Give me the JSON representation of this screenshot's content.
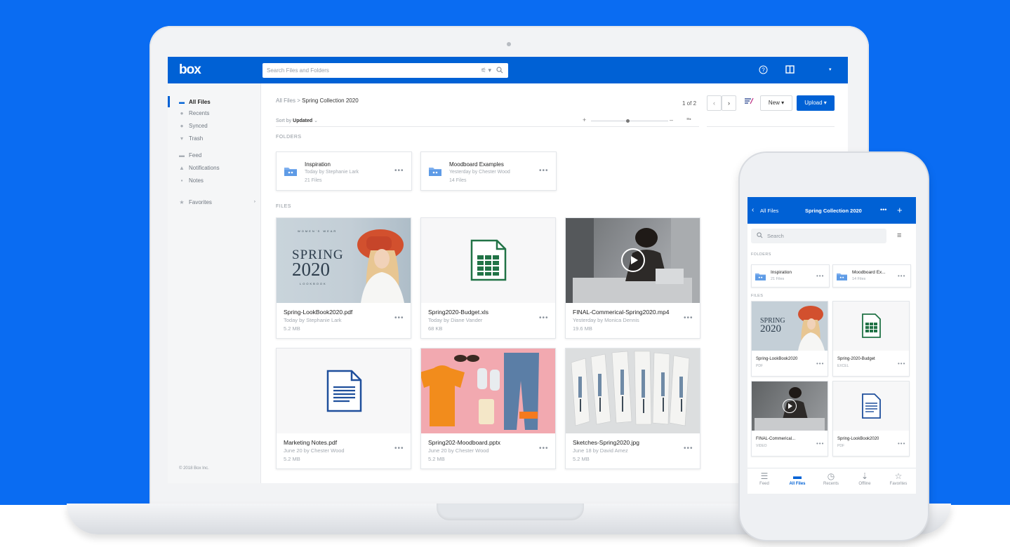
{
  "colors": {
    "brand_blue": "#0061d5",
    "background_blue": "#0a6cf2",
    "excel_green": "#217346",
    "doc_blue": "#1f4f9c"
  },
  "desktop": {
    "logo": "box",
    "search": {
      "placeholder": "Search Files and Folders"
    },
    "header_icons": [
      "help-icon",
      "panel-icon",
      "user-menu-chevron-icon"
    ],
    "sidebar": {
      "items": [
        {
          "label": "All Files",
          "icon": "folder-icon"
        },
        {
          "label": "Recents",
          "icon": "clock-icon"
        },
        {
          "label": "Synced",
          "icon": "sync-icon"
        },
        {
          "label": "Trash",
          "icon": "trash-icon"
        },
        {
          "label": "Feed",
          "icon": "feed-icon"
        },
        {
          "label": "Notifications",
          "icon": "bell-icon"
        },
        {
          "label": "Notes",
          "icon": "notes-icon"
        },
        {
          "label": "Favorites",
          "icon": "star-icon"
        }
      ],
      "copyright": "© 2018 Box Inc."
    },
    "breadcrumb": {
      "root": "All Files",
      "separator": ">",
      "current": "Spring Collection 2020"
    },
    "pager": {
      "text": "1 of 2"
    },
    "toolbar": {
      "new_label": "New ▾",
      "upload_label": "Upload ▾"
    },
    "sort": {
      "prefix": "Sort by",
      "value": "Updated"
    },
    "sections": {
      "folders": "FOLDERS",
      "files": "FILES"
    },
    "folders": [
      {
        "name": "Inspiration",
        "subtitle": "Today by Stephanie Lark",
        "count": "21 Files"
      },
      {
        "name": "Moodboard Examples",
        "subtitle": "Yesterday by Chester Wood",
        "count": "14 Files"
      }
    ],
    "files": [
      {
        "name": "Spring-LookBook2020.pdf",
        "subtitle": "Today by Stephanie Lark",
        "size": "5.2 MB",
        "thumb": "lookbook"
      },
      {
        "name": "Spring2020-Budget.xls",
        "subtitle": "Today by Diane Vander",
        "size": "68 KB",
        "thumb": "excel"
      },
      {
        "name": "FINAL-Commerical-Spring2020.mp4",
        "subtitle": "Yesterday by Monica Dennis",
        "size": "19.6 MB",
        "thumb": "video"
      },
      {
        "name": "Marketing Notes.pdf",
        "subtitle": "June 20 by Chester Wood",
        "size": "5.2 MB",
        "thumb": "document"
      },
      {
        "name": "Spring202-Moodboard.pptx",
        "subtitle": "June 20 by Chester Wood",
        "size": "5.2 MB",
        "thumb": "moodboard"
      },
      {
        "name": "Sketches-Spring2020.jpg",
        "subtitle": "June 18 by David Amez",
        "size": "5.2 MB",
        "thumb": "sketches"
      }
    ],
    "lookbook": {
      "line1": "WOMEN'S WEAR",
      "line2": "SPRING",
      "line3": "2020",
      "line4": "LOOKBOOK"
    }
  },
  "mobile": {
    "header": {
      "back_label": "All Files",
      "title": "Spring Collection 2020"
    },
    "search": {
      "placeholder": "Search"
    },
    "sections": {
      "folders": "FOLDERS",
      "files": "FILES"
    },
    "folders": [
      {
        "name": "Inspiration",
        "count": "21 Files"
      },
      {
        "name": "Moodboard Ex...",
        "count": "14 Files"
      }
    ],
    "files": [
      {
        "name": "Spring-LookBook2020",
        "type": "PDF",
        "thumb": "lookbook"
      },
      {
        "name": "Spring-2020-Budget",
        "type": "EXCEL",
        "thumb": "excel"
      },
      {
        "name": "FINAL-Commerical...",
        "type": "VIDEO",
        "thumb": "video"
      },
      {
        "name": "Spring-LookBook2020",
        "type": "PDF",
        "thumb": "document"
      }
    ],
    "nav": [
      {
        "label": "Feed",
        "icon": "feed-icon"
      },
      {
        "label": "All Files",
        "icon": "folder-icon"
      },
      {
        "label": "Recents",
        "icon": "clock-icon"
      },
      {
        "label": "Offline",
        "icon": "download-icon"
      },
      {
        "label": "Favorites",
        "icon": "star-icon"
      }
    ]
  }
}
